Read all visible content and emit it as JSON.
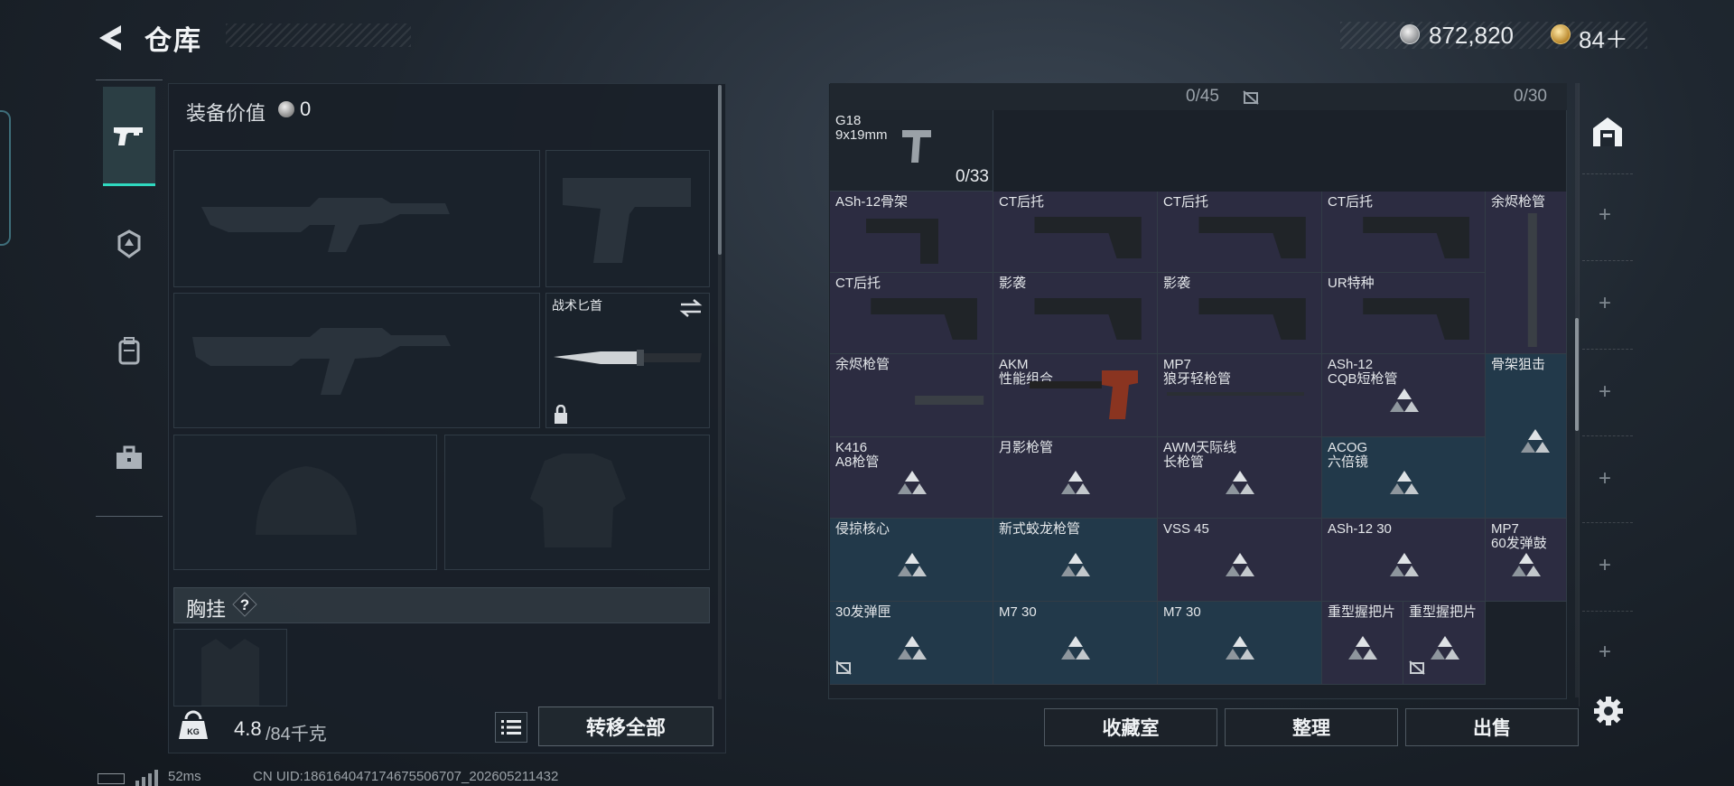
{
  "header": {
    "title": "仓库",
    "currency_silver": "872,820",
    "currency_gold": "84＋"
  },
  "left_panel": {
    "equip_value_label": "装备价值",
    "equip_value": "0",
    "knife_slot_label": "战术匕首",
    "chest_label": "胸挂",
    "chest_help": "?",
    "weight_current": "4.8",
    "weight_max": "/84千克",
    "transfer_all_label": "转移全部"
  },
  "grid": {
    "ammo_count_a": "0/45",
    "ammo_count_b": "0/30",
    "g18_count": "0/33",
    "cells": [
      {
        "line1": "G18",
        "line2": "9x19mm",
        "color": "dark"
      },
      {
        "line1": "ASh-12骨架",
        "line2": "",
        "color": "purple"
      },
      {
        "line1": "CT后托",
        "line2": "",
        "color": "purple"
      },
      {
        "line1": "CT后托",
        "line2": "",
        "color": "purple"
      },
      {
        "line1": "CT后托",
        "line2": "",
        "color": "purple"
      },
      {
        "line1": "余烬枪管",
        "line2": "",
        "color": "purple"
      },
      {
        "line1": "CT后托",
        "line2": "",
        "color": "purple"
      },
      {
        "line1": "影袭",
        "line2": "",
        "color": "purple"
      },
      {
        "line1": "影袭",
        "line2": "",
        "color": "purple"
      },
      {
        "line1": "UR特种",
        "line2": "",
        "color": "purple"
      },
      {
        "line1": "余烬枪管",
        "line2": "",
        "color": "purple"
      },
      {
        "line1": "AKM",
        "line2": "性能组合",
        "color": "purple"
      },
      {
        "line1": "MP7",
        "line2": "狼牙轻枪管",
        "color": "purple"
      },
      {
        "line1": "ASh-12",
        "line2": "CQB短枪管",
        "color": "purple"
      },
      {
        "line1": "骨架狙击",
        "line2": "",
        "color": "blue"
      },
      {
        "line1": "K416",
        "line2": "A8枪管",
        "color": "purple"
      },
      {
        "line1": "月影枪管",
        "line2": "",
        "color": "purple"
      },
      {
        "line1": "AWM天际线",
        "line2": "长枪管",
        "color": "purple"
      },
      {
        "line1": "ACOG",
        "line2": "六倍镜",
        "color": "blue"
      },
      {
        "line1": "侵掠核心",
        "line2": "",
        "color": "blue"
      },
      {
        "line1": "新式蛟龙枪管",
        "line2": "",
        "color": "blue"
      },
      {
        "line1": "VSS 45",
        "line2": "",
        "color": "purple"
      },
      {
        "line1": "ASh-12 30",
        "line2": "",
        "color": "purple"
      },
      {
        "line1": "MP7",
        "line2": "60发弹鼓",
        "color": "purple"
      },
      {
        "line1": "30发弹匣",
        "line2": "",
        "color": "blue"
      },
      {
        "line1": "M7 30",
        "line2": "",
        "color": "blue"
      },
      {
        "line1": "M7 30",
        "line2": "",
        "color": "blue"
      },
      {
        "line1": "重型握把片",
        "line2": "",
        "color": "purple"
      },
      {
        "line1": "重型握把片",
        "line2": "",
        "color": "purple"
      }
    ]
  },
  "buttons": {
    "collection": "收藏室",
    "organize": "整理",
    "sell": "出售"
  },
  "status": {
    "ping": "52ms",
    "uid": "CN UID:1861640471746755067​07_202605211432"
  },
  "colors": {
    "accent": "#2fd9c0",
    "cell_purple": "#2c2c41",
    "cell_blue": "#22394a",
    "gold": "#d6a64a"
  }
}
